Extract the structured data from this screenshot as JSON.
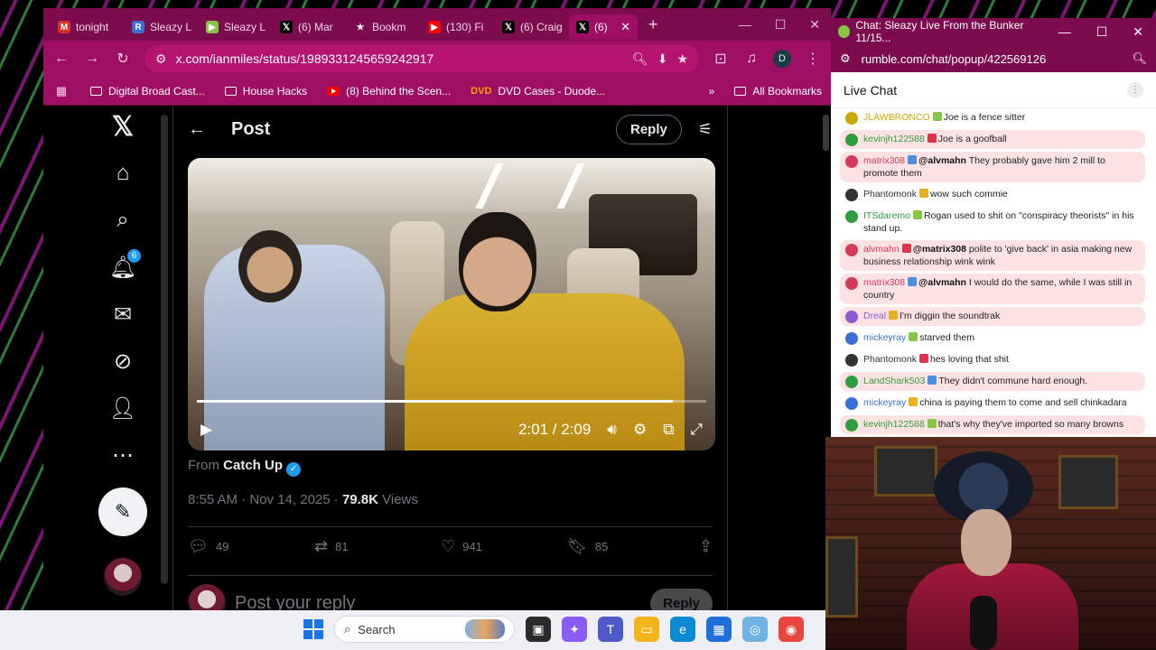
{
  "browser": {
    "tabs": [
      {
        "icon": "gmail-icon",
        "title": "tonight",
        "color": "#d93025",
        "glyph": "M"
      },
      {
        "icon": "r-icon",
        "title": "Sleazy L",
        "color": "#3b6fd8",
        "glyph": "R"
      },
      {
        "icon": "rumble-icon",
        "title": "Sleazy L",
        "color": "#85c742",
        "glyph": "▶"
      },
      {
        "icon": "x-icon",
        "title": "(6) Mar",
        "color": "#000000",
        "glyph": "𝕏"
      },
      {
        "icon": "star-icon",
        "title": "Bookm",
        "color": "#7d0c4e",
        "glyph": "★"
      },
      {
        "icon": "youtube-icon",
        "title": "(130) Fi",
        "color": "#ff0000",
        "glyph": "▶"
      },
      {
        "icon": "x-icon",
        "title": "(6) Craig",
        "color": "#000000",
        "glyph": "𝕏"
      },
      {
        "icon": "x-icon",
        "title": "(6)",
        "color": "#000000",
        "glyph": "𝕏",
        "active": true
      }
    ],
    "url": "x.com/ianmiles/status/1989331245659242917",
    "profile_initial": "D",
    "bookmarks": [
      {
        "icon": "folder-icon",
        "label": "Digital Broad Cast..."
      },
      {
        "icon": "folder-icon",
        "label": "House Hacks"
      },
      {
        "icon": "youtube-icon",
        "label": "(8) Behind the Scen..."
      },
      {
        "icon": "dvd-icon",
        "label": "DVD Cases - Duode..."
      }
    ],
    "all_bookmarks_label": "All Bookmarks"
  },
  "xnav": {
    "notification_count": "6"
  },
  "post": {
    "header_title": "Post",
    "reply_button": "Reply",
    "video_time": "2:01 / 2:09",
    "video_progress": 0.935,
    "from_prefix": "From",
    "from_account": "Catch Up",
    "timestamp": "8:55 AM · Nov 14, 2025 ·",
    "views_count": "79.8K",
    "views_label": "Views",
    "replies": "49",
    "reposts": "81",
    "likes": "941",
    "bookmarks": "85",
    "reply_placeholder": "Post your reply",
    "reply_submit": "Reply"
  },
  "chat": {
    "window_title": "Chat: Sleazy Live From the Bunker 11/15...",
    "url": "rumble.com/chat/popup/422569126",
    "heading": "Live Chat",
    "messages": [
      {
        "user": "JLAWBRONCO",
        "user_color": "#c9a800",
        "text": "Joe is a fence sitter",
        "mention": "",
        "hl": false
      },
      {
        "user": "kevinjh122588",
        "user_color": "#2e9e3f",
        "text": "Joe is a goofball",
        "mention": "",
        "hl": true
      },
      {
        "user": "matrix308",
        "user_color": "#d63a5a",
        "text": "They probably gave him 2 mill to promote them",
        "mention": "@alvmahn",
        "hl": true
      },
      {
        "user": "Phantomonk",
        "user_color": "#333333",
        "text": "wow such commie",
        "mention": "",
        "hl": false
      },
      {
        "user": "ITSdaremo",
        "user_color": "#2e9e3f",
        "text": "Rogan used to shit on \"conspiracy theorists\" in his stand up.",
        "mention": "",
        "hl": false
      },
      {
        "user": "alvmahn",
        "user_color": "#d63a5a",
        "text": "polite to 'give back' in asia making new business relationship wink wink",
        "mention": "@matrix308",
        "hl": true
      },
      {
        "user": "matrix308",
        "user_color": "#d63a5a",
        "text": "I would do the same, while I was still in country",
        "mention": "@alvmahn",
        "hl": true
      },
      {
        "user": "Dreal",
        "user_color": "#8a5cd0",
        "text": "I'm diggin the soundtrak",
        "mention": "",
        "hl": true
      },
      {
        "user": "mickeyray",
        "user_color": "#3b6fd8",
        "text": "starved them",
        "mention": "",
        "hl": false
      },
      {
        "user": "Phantomonk",
        "user_color": "#333333",
        "text": "hes loving that shit",
        "mention": "",
        "hl": false
      },
      {
        "user": "LandShark503",
        "user_color": "#2e9e3f",
        "text": "They didn't commune hard enough.",
        "mention": "",
        "hl": true
      },
      {
        "user": "mickeyray",
        "user_color": "#3b6fd8",
        "text": "china is paying them to come and sell chinkadara",
        "mention": "",
        "hl": false
      },
      {
        "user": "kevinjh122588",
        "user_color": "#2e9e3f",
        "text": "that's why they've imported so many browns",
        "mention": "",
        "hl": true
      }
    ]
  },
  "taskbar": {
    "search_placeholder": "Search"
  }
}
